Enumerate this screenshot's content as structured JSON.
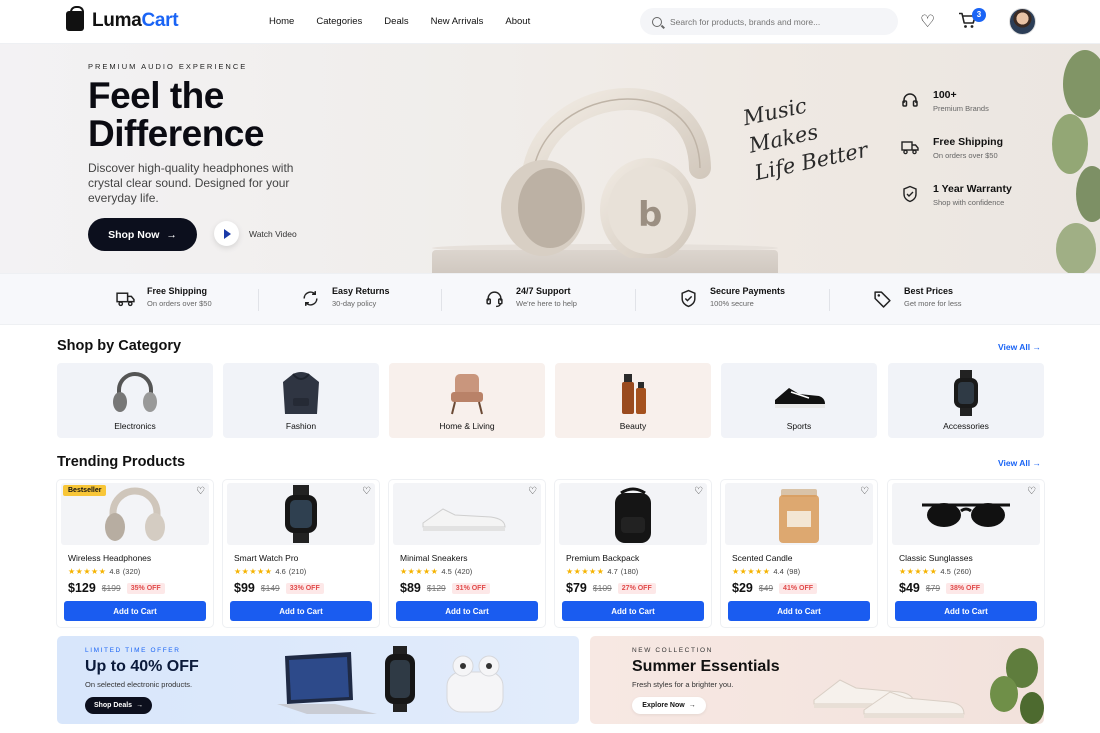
{
  "brand": {
    "name_part1": "Luma",
    "name_part2": "Cart"
  },
  "nav": [
    "Home",
    "Categories",
    "Deals",
    "New Arrivals",
    "About"
  ],
  "search": {
    "placeholder": "Search for products, brands and more..."
  },
  "cart": {
    "count": "3"
  },
  "hero": {
    "eyebrow": "PREMIUM AUDIO EXPERIENCE",
    "title_line1": "Feel the",
    "title_line2": "Difference",
    "description": "Discover high-quality headphones with crystal clear sound. Designed for your everyday life.",
    "shop_label": "Shop Now",
    "watch_label": "Watch Video",
    "script_lines": [
      "Music",
      "Makes",
      "Life Better"
    ],
    "features": [
      {
        "icon": "headphones-icon",
        "title": "100+",
        "sub": "Premium Brands"
      },
      {
        "icon": "truck-icon",
        "title": "Free Shipping",
        "sub": "On orders over $50"
      },
      {
        "icon": "shield-icon",
        "title": "1 Year Warranty",
        "sub": "Shop with confidence"
      }
    ]
  },
  "strip": [
    {
      "icon": "truck-icon",
      "title": "Free Shipping",
      "sub": "On orders over $50"
    },
    {
      "icon": "returns-icon",
      "title": "Easy Returns",
      "sub": "30-day policy"
    },
    {
      "icon": "support-icon",
      "title": "24/7 Support",
      "sub": "We're here to help"
    },
    {
      "icon": "shield-icon",
      "title": "Secure Payments",
      "sub": "100% secure"
    },
    {
      "icon": "tag-icon",
      "title": "Best Prices",
      "sub": "Get more for less"
    }
  ],
  "categories": {
    "title": "Shop by Category",
    "view_all": "View All",
    "items": [
      {
        "label": "Electronics",
        "icon": "headphones-icon",
        "bg": "#f1f3f8"
      },
      {
        "label": "Fashion",
        "icon": "hoodie-icon",
        "bg": "#f1f3f8"
      },
      {
        "label": "Home & Living",
        "icon": "armchair-icon",
        "bg": "#f8f0ec"
      },
      {
        "label": "Beauty",
        "icon": "perfume-icon",
        "bg": "#f8f0ec"
      },
      {
        "label": "Sports",
        "icon": "sneaker-icon",
        "bg": "#f1f3f8"
      },
      {
        "label": "Accessories",
        "icon": "watch-icon",
        "bg": "#f1f3f8"
      }
    ]
  },
  "trending": {
    "title": "Trending Products",
    "view_all": "View All",
    "badge": "Bestseller",
    "add_label": "Add to Cart",
    "items": [
      {
        "name": "Wireless Headphones",
        "rating": "4.8",
        "reviews": "(320)",
        "price": "$129",
        "old": "$199",
        "off": "35% OFF",
        "icon": "headphones-icon"
      },
      {
        "name": "Smart Watch Pro",
        "rating": "4.6",
        "reviews": "(210)",
        "price": "$99",
        "old": "$149",
        "off": "33% OFF",
        "icon": "watch-icon"
      },
      {
        "name": "Minimal Sneakers",
        "rating": "4.5",
        "reviews": "(420)",
        "price": "$89",
        "old": "$129",
        "off": "31% OFF",
        "icon": "sneaker-icon"
      },
      {
        "name": "Premium Backpack",
        "rating": "4.7",
        "reviews": "(180)",
        "price": "$79",
        "old": "$109",
        "off": "27% OFF",
        "icon": "backpack-icon"
      },
      {
        "name": "Scented Candle",
        "rating": "4.4",
        "reviews": "(98)",
        "price": "$29",
        "old": "$49",
        "off": "41% OFF",
        "icon": "candle-icon"
      },
      {
        "name": "Classic Sunglasses",
        "rating": "4.5",
        "reviews": "(260)",
        "price": "$49",
        "old": "$79",
        "off": "38% OFF",
        "icon": "sunglasses-icon"
      }
    ]
  },
  "promo_left": {
    "eyebrow": "LIMITED TIME OFFER",
    "title": "Up to 40% OFF",
    "sub": "On selected electronic products.",
    "btn": "Shop Deals"
  },
  "promo_right": {
    "eyebrow": "NEW COLLECTION",
    "title": "Summer Essentials",
    "sub": "Fresh styles for a brighter you.",
    "btn": "Explore Now"
  }
}
